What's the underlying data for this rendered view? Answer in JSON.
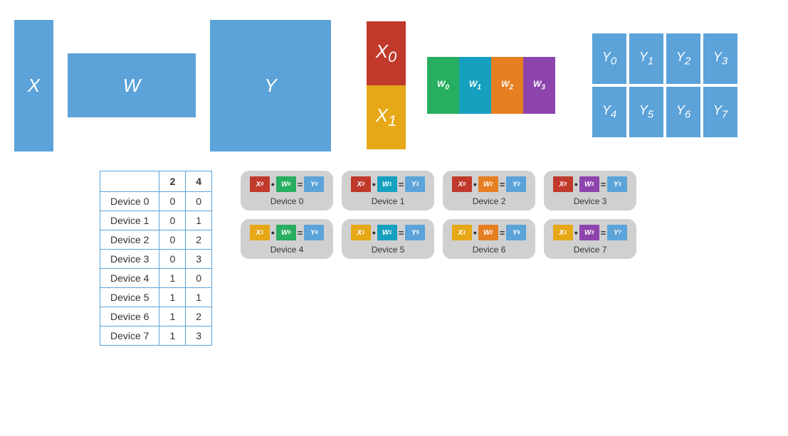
{
  "top": {
    "x_label": "X",
    "w_label": "W",
    "y_label": "Y",
    "x0_label": "X₀",
    "x1_label": "X₁",
    "w_parts": [
      "W₀",
      "W₁",
      "W₂",
      "W₃"
    ],
    "y_grid": [
      "Y₀",
      "Y₁",
      "Y₂",
      "Y₃",
      "Y₄",
      "Y₅",
      "Y₆",
      "Y₇"
    ]
  },
  "table": {
    "col1": "",
    "col2": "2",
    "col3": "4",
    "rows": [
      {
        "label": "Device 0",
        "c2": "0",
        "c3": "0"
      },
      {
        "label": "Device 1",
        "c2": "0",
        "c3": "1"
      },
      {
        "label": "Device 2",
        "c2": "0",
        "c3": "2"
      },
      {
        "label": "Device 3",
        "c2": "0",
        "c3": "3"
      },
      {
        "label": "Device 4",
        "c2": "1",
        "c3": "0"
      },
      {
        "label": "Device 5",
        "c2": "1",
        "c3": "1"
      },
      {
        "label": "Device 6",
        "c2": "1",
        "c3": "2"
      },
      {
        "label": "Device 7",
        "c2": "1",
        "c3": "3"
      }
    ]
  },
  "devices": {
    "row1": [
      {
        "x": "X₀",
        "xColor": "#c0392b",
        "w": "W₀",
        "wColor": "#27ae60",
        "y": "Y₀",
        "yColor": "#5ba3d9",
        "label": "Device 0"
      },
      {
        "x": "X₀",
        "xColor": "#c0392b",
        "w": "W₁",
        "wColor": "#16a0c0",
        "y": "Y₁",
        "yColor": "#5ba3d9",
        "label": "Device 1"
      },
      {
        "x": "X₀",
        "xColor": "#c0392b",
        "w": "W₂",
        "wColor": "#e67e22",
        "y": "Y₂",
        "yColor": "#5ba3d9",
        "label": "Device 2"
      },
      {
        "x": "X₀",
        "xColor": "#c0392b",
        "w": "W₃",
        "wColor": "#8e44ad",
        "y": "Y₃",
        "yColor": "#5ba3d9",
        "label": "Device 3"
      }
    ],
    "row2": [
      {
        "x": "X₁",
        "xColor": "#e6a817",
        "w": "W₀",
        "wColor": "#27ae60",
        "y": "Y₄",
        "yColor": "#5ba3d9",
        "label": "Device 4"
      },
      {
        "x": "X₁",
        "xColor": "#e6a817",
        "w": "W₁",
        "wColor": "#16a0c0",
        "y": "Y₅",
        "yColor": "#5ba3d9",
        "label": "Device 5"
      },
      {
        "x": "X₁",
        "xColor": "#e6a817",
        "w": "W₂",
        "wColor": "#e67e22",
        "y": "Y₆",
        "yColor": "#5ba3d9",
        "label": "Device 6"
      },
      {
        "x": "X₁",
        "xColor": "#e6a817",
        "w": "W₃",
        "wColor": "#8e44ad",
        "y": "Y₇",
        "yColor": "#5ba3d9",
        "label": "Device 7"
      }
    ]
  }
}
